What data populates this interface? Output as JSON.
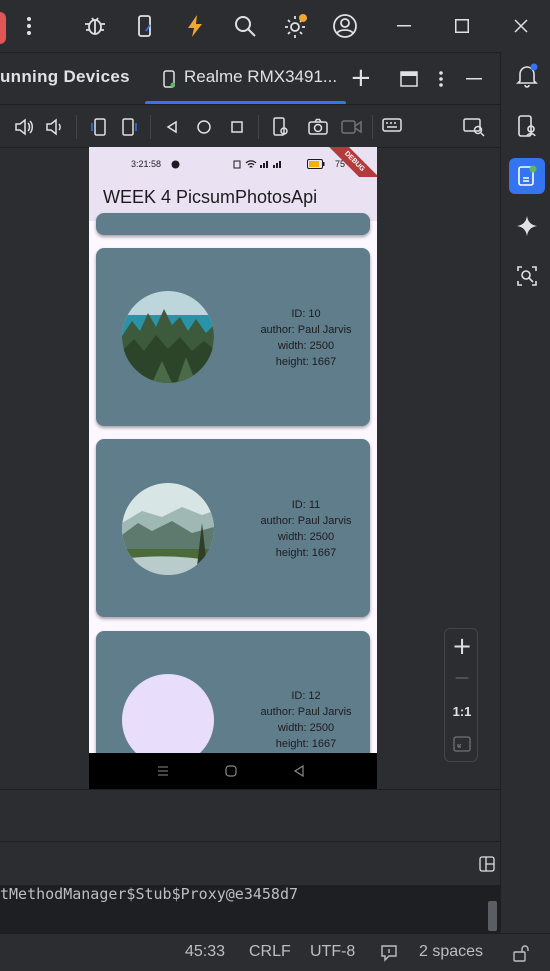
{
  "titlebar": {
    "icons": [
      "more-vert-icon",
      "bug-icon",
      "device-manager-icon",
      "lightning-icon",
      "search-icon",
      "settings-icon",
      "account-icon",
      "minimize-icon",
      "maximize-icon",
      "close-icon"
    ]
  },
  "tabs": {
    "running_devices": "unning Devices",
    "device_tab": "Realme RMX3491...",
    "add_label": "+"
  },
  "phone": {
    "status_time": "3:21:58",
    "battery": "75",
    "debug_label": "DEBUG",
    "app_title": "WEEK 4 PicsumPhotosApi",
    "cards": [
      {
        "id": "ID: 10",
        "author": "author: Paul Jarvis",
        "width": "width: 2500",
        "height": "height: 1667",
        "image": "forest-lake"
      },
      {
        "id": "ID: 11",
        "author": "author: Paul Jarvis",
        "width": "width: 2500",
        "height": "height: 1667",
        "image": "misty-river"
      },
      {
        "id": "ID: 12",
        "author": "author: Paul Jarvis",
        "width": "width: 2500",
        "height": "height: 1667",
        "image": "placeholder"
      }
    ]
  },
  "zoom": {
    "plus": "+",
    "minus": "—",
    "one_to_one": "1:1"
  },
  "console": {
    "text": "tMethodManager$Stub$Proxy@e3458d7"
  },
  "status": {
    "position": "45:33",
    "line_ending": "CRLF",
    "encoding": "UTF-8",
    "indent": "2 spaces"
  },
  "colors": {
    "accent": "#3574f0",
    "card": "#607d8b",
    "appbar": "#eae2f2",
    "debug": "#b33b3b"
  }
}
